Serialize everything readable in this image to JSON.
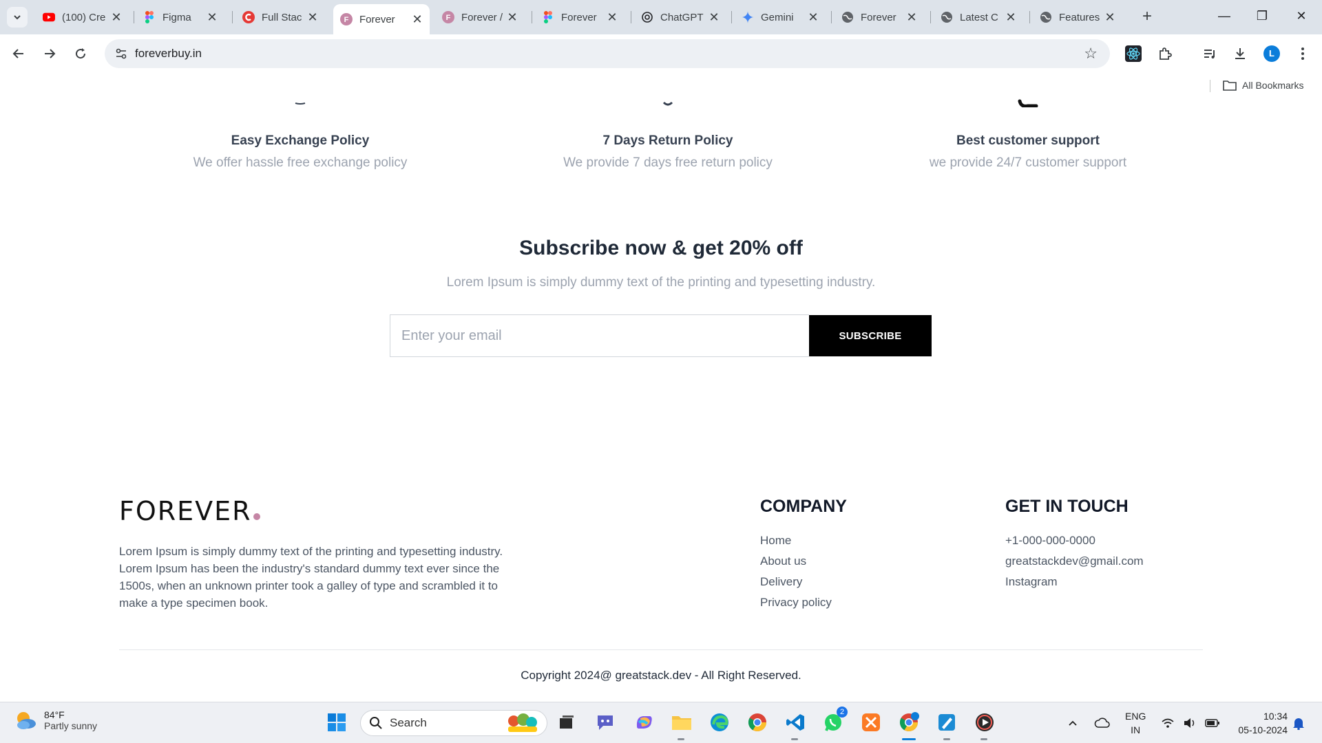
{
  "browser": {
    "tabs": [
      {
        "title": "(100) Cre",
        "icon": "youtube-icon",
        "color": "#ff0000"
      },
      {
        "title": "Figma",
        "icon": "figma-icon",
        "color": "#f24e1e"
      },
      {
        "title": "Full Stac",
        "icon": "greatstack-icon",
        "color": "#e53935"
      },
      {
        "title": "Forever",
        "icon": "forever-icon",
        "color": "#c586a5",
        "active": true
      },
      {
        "title": "Forever /",
        "icon": "forever-icon",
        "color": "#c586a5"
      },
      {
        "title": "Forever",
        "icon": "figma-icon",
        "color": "#f24e1e"
      },
      {
        "title": "ChatGPT",
        "icon": "chatgpt-icon",
        "color": "#202124"
      },
      {
        "title": "Gemini",
        "icon": "gemini-icon",
        "color": "#4285f4"
      },
      {
        "title": "Forever",
        "icon": "globe-icon",
        "color": "#5f6368"
      },
      {
        "title": "Latest C",
        "icon": "globe-icon",
        "color": "#5f6368"
      },
      {
        "title": "Features",
        "icon": "globe-icon",
        "color": "#5f6368"
      }
    ],
    "url": "foreverbuy.in",
    "profile_initial": "L",
    "bookmarks_label": "All Bookmarks"
  },
  "policies": [
    {
      "title": "Easy Exchange Policy",
      "desc": "We offer hassle free exchange policy"
    },
    {
      "title": "7 Days Return Policy",
      "desc": "We provide 7 days free return policy"
    },
    {
      "title": "Best customer support",
      "desc": "we provide 24/7 customer support"
    }
  ],
  "subscribe": {
    "title": "Subscribe now & get 20% off",
    "subtitle": "Lorem Ipsum is simply dummy text of the printing and typesetting industry.",
    "placeholder": "Enter your email",
    "button": "SUBSCRIBE"
  },
  "footer": {
    "logo": "FOREVER",
    "logo_dot_color": "#c586a5",
    "description": "Lorem Ipsum is simply dummy text of the printing and typesetting industry. Lorem Ipsum has been the industry's standard dummy text ever since the 1500s, when an unknown printer took a galley of type and scrambled it to make a type specimen book.",
    "company": {
      "heading": "COMPANY",
      "links": [
        "Home",
        "About us",
        "Delivery",
        "Privacy policy"
      ]
    },
    "contact": {
      "heading": "GET IN TOUCH",
      "items": [
        "+1-000-000-0000",
        "greatstackdev@gmail.com",
        "Instagram"
      ]
    },
    "copyright": "Copyright 2024@ greatstack.dev - All Right Reserved."
  },
  "taskbar": {
    "weather_temp": "84°F",
    "weather_cond": "Partly sunny",
    "search_label": "Search",
    "lang_line1": "ENG",
    "lang_line2": "IN",
    "time": "10:34",
    "date": "05-10-2024",
    "whatsapp_badge": "2"
  }
}
